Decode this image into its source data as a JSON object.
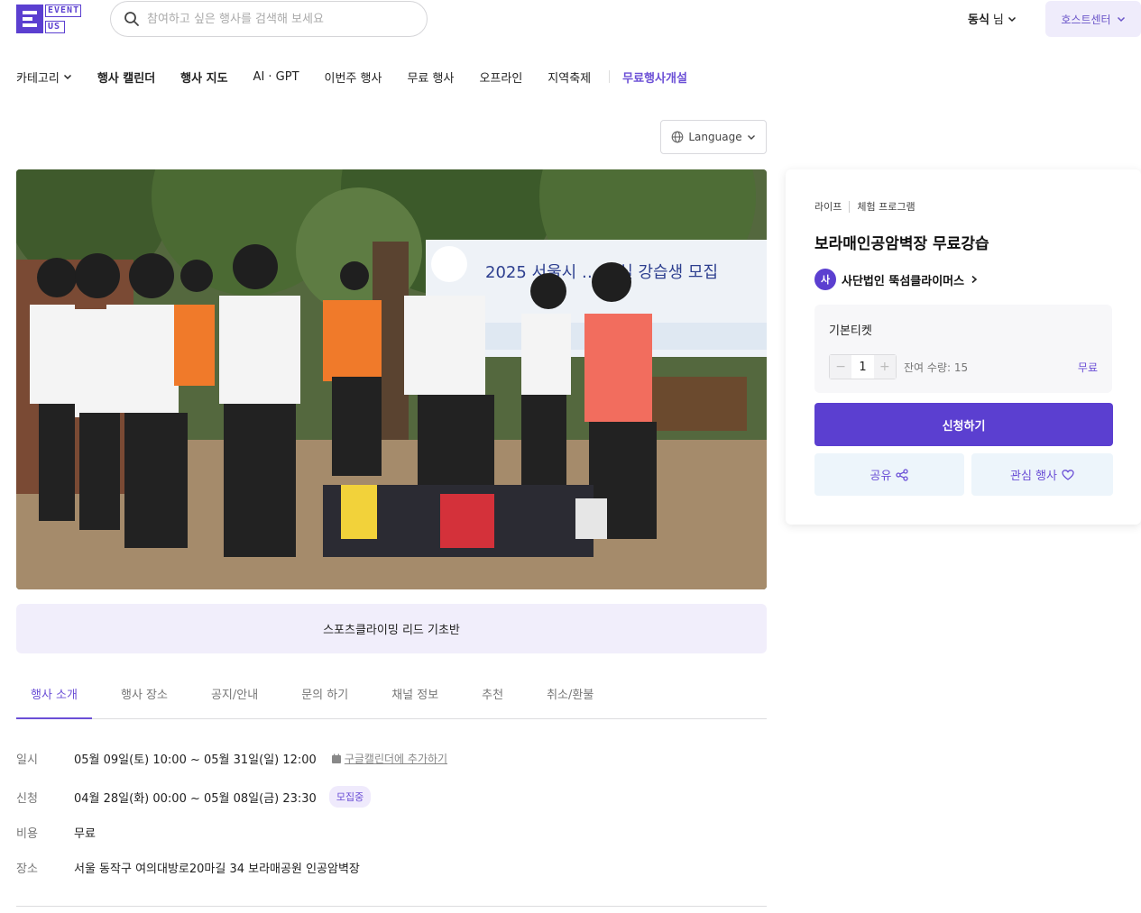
{
  "header": {
    "logo_line1": "EVENT",
    "logo_line2": "US",
    "search_placeholder": "참여하고 싶은 행사를 검색해 보세요",
    "user_name": "동식",
    "user_suffix": "님",
    "host_center": "호스트센터"
  },
  "nav": {
    "items": [
      "카테고리",
      "행사 캘린더",
      "행사 지도",
      "AI · GPT",
      "이번주 행사",
      "무료 행사",
      "오프라인",
      "지역축제",
      "무료행사개설"
    ]
  },
  "language_label": "Language",
  "photo": {
    "banner_text": "2025 서울시 … 교실 강습생 모집"
  },
  "caption": "스포츠클라이밍 리드 기초반",
  "tabs": [
    "행사 소개",
    "행사 장소",
    "공지/안내",
    "문의 하기",
    "채널 정보",
    "추천",
    "취소/환불"
  ],
  "info": {
    "date_label": "일시",
    "date_value": "05월 09일(토) 10:00 ~ 05월 31일(일) 12:00",
    "gcal_link": "구글캘린더에 추가하기",
    "apply_label": "신청",
    "apply_value": "04월 28일(화) 00:00 ~ 05월 08일(금) 23:30",
    "apply_badge": "모집중",
    "cost_label": "비용",
    "cost_value": "무료",
    "place_label": "장소",
    "place_value": "서울 동작구 여의대방로20마길 34 보라매공원 인공암벽장"
  },
  "card": {
    "category1": "라이프",
    "category2": "체험 프로그램",
    "title": "보라매인공암벽장 무료강습",
    "org_initial": "사",
    "org_name": "사단법인 뚝섬클라이머스",
    "ticket_name": "기본티켓",
    "ticket_qty": "1",
    "ticket_remaining": "잔여 수량: 15",
    "ticket_price": "무료",
    "apply_button": "신청하기",
    "share_button": "공유",
    "fav_button": "관심 행사"
  },
  "colors": {
    "accent": "#5b3fd0",
    "accent_light": "#efecfb",
    "link": "#6b4fd6"
  }
}
